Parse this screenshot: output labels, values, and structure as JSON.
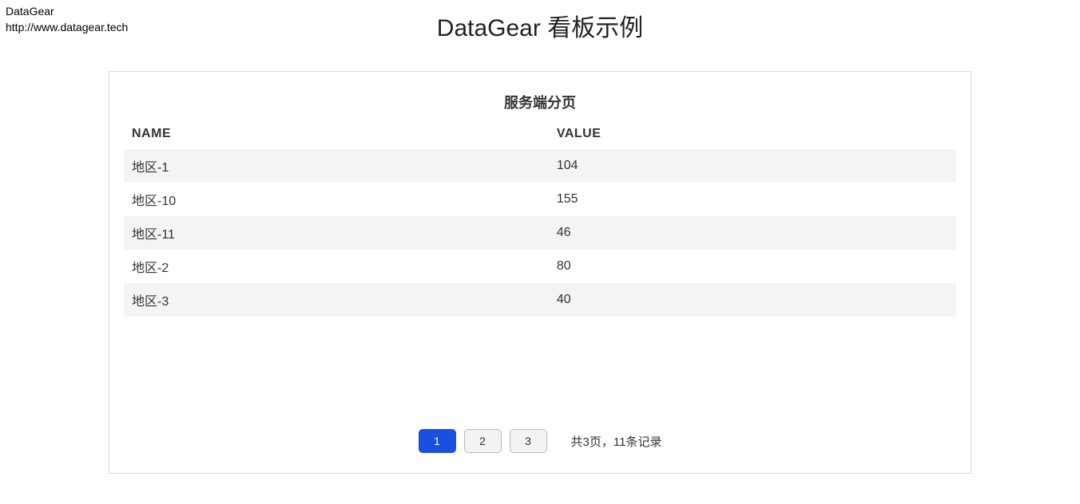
{
  "meta": {
    "brand": "DataGear",
    "url": "http://www.datagear.tech"
  },
  "title": "DataGear 看板示例",
  "panel": {
    "title": "服务端分页",
    "columns": [
      "NAME",
      "VALUE"
    ],
    "rows": [
      {
        "name": "地区-1",
        "value": "104"
      },
      {
        "name": "地区-10",
        "value": "155"
      },
      {
        "name": "地区-11",
        "value": "46"
      },
      {
        "name": "地区-2",
        "value": "80"
      },
      {
        "name": "地区-3",
        "value": "40"
      }
    ]
  },
  "pagination": {
    "pages": [
      "1",
      "2",
      "3"
    ],
    "active_index": 0,
    "summary": "共3页，11条记录"
  }
}
